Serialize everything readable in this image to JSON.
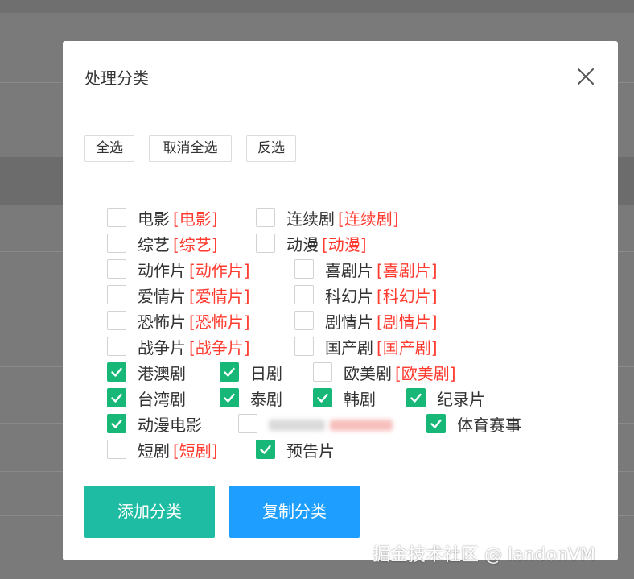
{
  "modal": {
    "title": "处理分类"
  },
  "select_buttons": {
    "select_all": "全选",
    "deselect_all": "取消全选",
    "invert": "反选"
  },
  "rows": [
    [
      {
        "label": "电影",
        "tag": "[电影]",
        "checked": false
      },
      {
        "label": "连续剧",
        "tag": "[连续剧]",
        "checked": false
      }
    ],
    [
      {
        "label": "综艺",
        "tag": "[综艺]",
        "checked": false
      },
      {
        "label": "动漫",
        "tag": "[动漫]",
        "checked": false
      }
    ],
    [
      {
        "label": "动作片",
        "tag": "[动作片]",
        "checked": false
      },
      {
        "label": "喜剧片",
        "tag": "[喜剧片]",
        "checked": false
      }
    ],
    [
      {
        "label": "爱情片",
        "tag": "[爱情片]",
        "checked": false
      },
      {
        "label": "科幻片",
        "tag": "[科幻片]",
        "checked": false
      }
    ],
    [
      {
        "label": "恐怖片",
        "tag": "[恐怖片]",
        "checked": false
      },
      {
        "label": "剧情片",
        "tag": "[剧情片]",
        "checked": false
      }
    ],
    [
      {
        "label": "战争片",
        "tag": "[战争片]",
        "checked": false
      },
      {
        "label": "国产剧",
        "tag": "[国产剧]",
        "checked": false
      }
    ],
    [
      {
        "label": "港澳剧",
        "tag": "",
        "checked": true
      },
      {
        "label": "日剧",
        "tag": "",
        "checked": true
      },
      {
        "label": "欧美剧",
        "tag": "[欧美剧]",
        "checked": false
      }
    ],
    [
      {
        "label": "台湾剧",
        "tag": "",
        "checked": true
      },
      {
        "label": "泰剧",
        "tag": "",
        "checked": true
      },
      {
        "label": "韩剧",
        "tag": "",
        "checked": true
      },
      {
        "label": "纪录片",
        "tag": "",
        "checked": true
      }
    ],
    [
      {
        "label": "动漫电影",
        "tag": "",
        "checked": true
      },
      {
        "label": "",
        "tag": "",
        "checked": false,
        "obscured": true
      },
      {
        "label": "体育赛事",
        "tag": "",
        "checked": true
      }
    ],
    [
      {
        "label": "短剧",
        "tag": "[短剧]",
        "checked": false
      },
      {
        "label": "预告片",
        "tag": "",
        "checked": true
      }
    ]
  ],
  "actions": {
    "add": "添加分类",
    "copy": "复制分类"
  },
  "colors": {
    "accent_green": "#16b777",
    "teal": "#1ebca2",
    "blue": "#1e9fff",
    "tag_red": "#ff3b30"
  },
  "watermark": "掘金技术社区 @ landonVM"
}
